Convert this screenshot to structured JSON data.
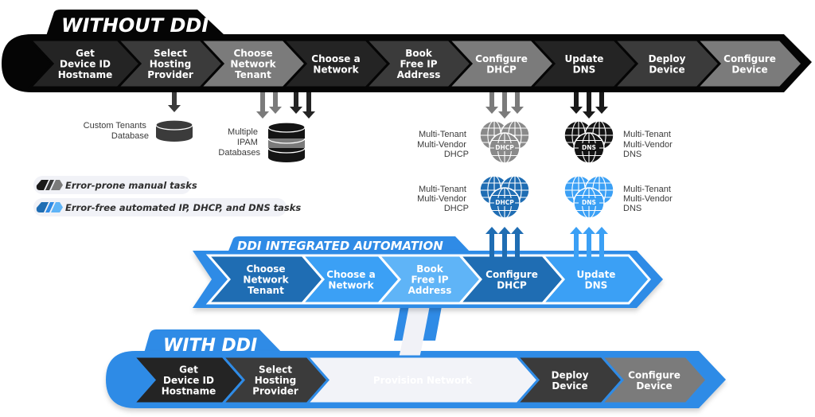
{
  "colors": {
    "black": "#050505",
    "dark1": "#242424",
    "dark2": "#3b3b3b",
    "gray": "#7b7b7b",
    "blue_dark": "#1f6db3",
    "blue_mid": "#2f8be6",
    "blue_light": "#3ba0f5",
    "blue_pale": "#5fb4f7",
    "provision_bg": "#f2f3f8",
    "provision_text": "#2f8be6"
  },
  "without_ddi": {
    "title": "WITHOUT DDI",
    "steps": [
      {
        "lines": [
          "Get",
          "Device ID",
          "Hostname"
        ],
        "style": "dark1"
      },
      {
        "lines": [
          "Select",
          "Hosting",
          "Provider"
        ],
        "style": "dark2"
      },
      {
        "lines": [
          "Choose",
          "Network",
          "Tenant"
        ],
        "style": "gray"
      },
      {
        "lines": [
          "Choose a",
          "Network"
        ],
        "style": "dark1"
      },
      {
        "lines": [
          "Book",
          "Free IP",
          "Address"
        ],
        "style": "dark2"
      },
      {
        "lines": [
          "Configure",
          "DHCP"
        ],
        "style": "gray"
      },
      {
        "lines": [
          "Update",
          "DNS"
        ],
        "style": "dark1"
      },
      {
        "lines": [
          "Deploy",
          "Device"
        ],
        "style": "dark2"
      },
      {
        "lines": [
          "Configure",
          "Device"
        ],
        "style": "gray"
      }
    ]
  },
  "databases": {
    "custom_tenants": {
      "lines": [
        "Custom Tenants",
        "Database"
      ]
    },
    "ipam": {
      "lines": [
        "Multiple",
        "IPAM",
        "Databases"
      ]
    }
  },
  "services": {
    "manual_dhcp": {
      "lines": [
        "Multi-Tenant",
        "Multi-Vendor",
        "DHCP"
      ],
      "icon_label": "DHCP"
    },
    "manual_dns": {
      "lines": [
        "Multi-Tenant",
        "Multi-Vendor",
        "DNS"
      ],
      "icon_label": "DNS"
    },
    "auto_dhcp": {
      "lines": [
        "Multi-Tenant",
        "Multi-Vendor",
        "DHCP"
      ],
      "icon_label": "DHCP"
    },
    "auto_dns": {
      "lines": [
        "Multi-Tenant",
        "Multi-Vendor",
        "DNS"
      ],
      "icon_label": "DNS"
    }
  },
  "legend": [
    {
      "label": "Error-prone manual tasks",
      "kind": "manual"
    },
    {
      "label": "Error-free automated IP, DHCP, and DNS tasks",
      "kind": "automated"
    }
  ],
  "ddi_automation": {
    "title": "DDI INTEGRATED AUTOMATION",
    "steps": [
      {
        "lines": [
          "Choose",
          "Network",
          "Tenant"
        ],
        "style": "blue_dark"
      },
      {
        "lines": [
          "Choose a",
          "Network"
        ],
        "style": "blue_light"
      },
      {
        "lines": [
          "Book",
          "Free IP",
          "Address"
        ],
        "style": "blue_pale"
      },
      {
        "lines": [
          "Configure",
          "DHCP"
        ],
        "style": "blue_dark"
      },
      {
        "lines": [
          "Update",
          "DNS"
        ],
        "style": "blue_light"
      }
    ]
  },
  "with_ddi": {
    "title": "WITH DDI",
    "steps": [
      {
        "lines": [
          "Get",
          "Device ID",
          "Hostname"
        ],
        "style": "dark1"
      },
      {
        "lines": [
          "Select",
          "Hosting",
          "Provider"
        ],
        "style": "dark2"
      },
      {
        "lines": [
          "Provision Network"
        ],
        "style": "provision"
      },
      {
        "lines": [
          "Deploy",
          "Device"
        ],
        "style": "dark2"
      },
      {
        "lines": [
          "Configure",
          "Device"
        ],
        "style": "gray"
      }
    ]
  }
}
